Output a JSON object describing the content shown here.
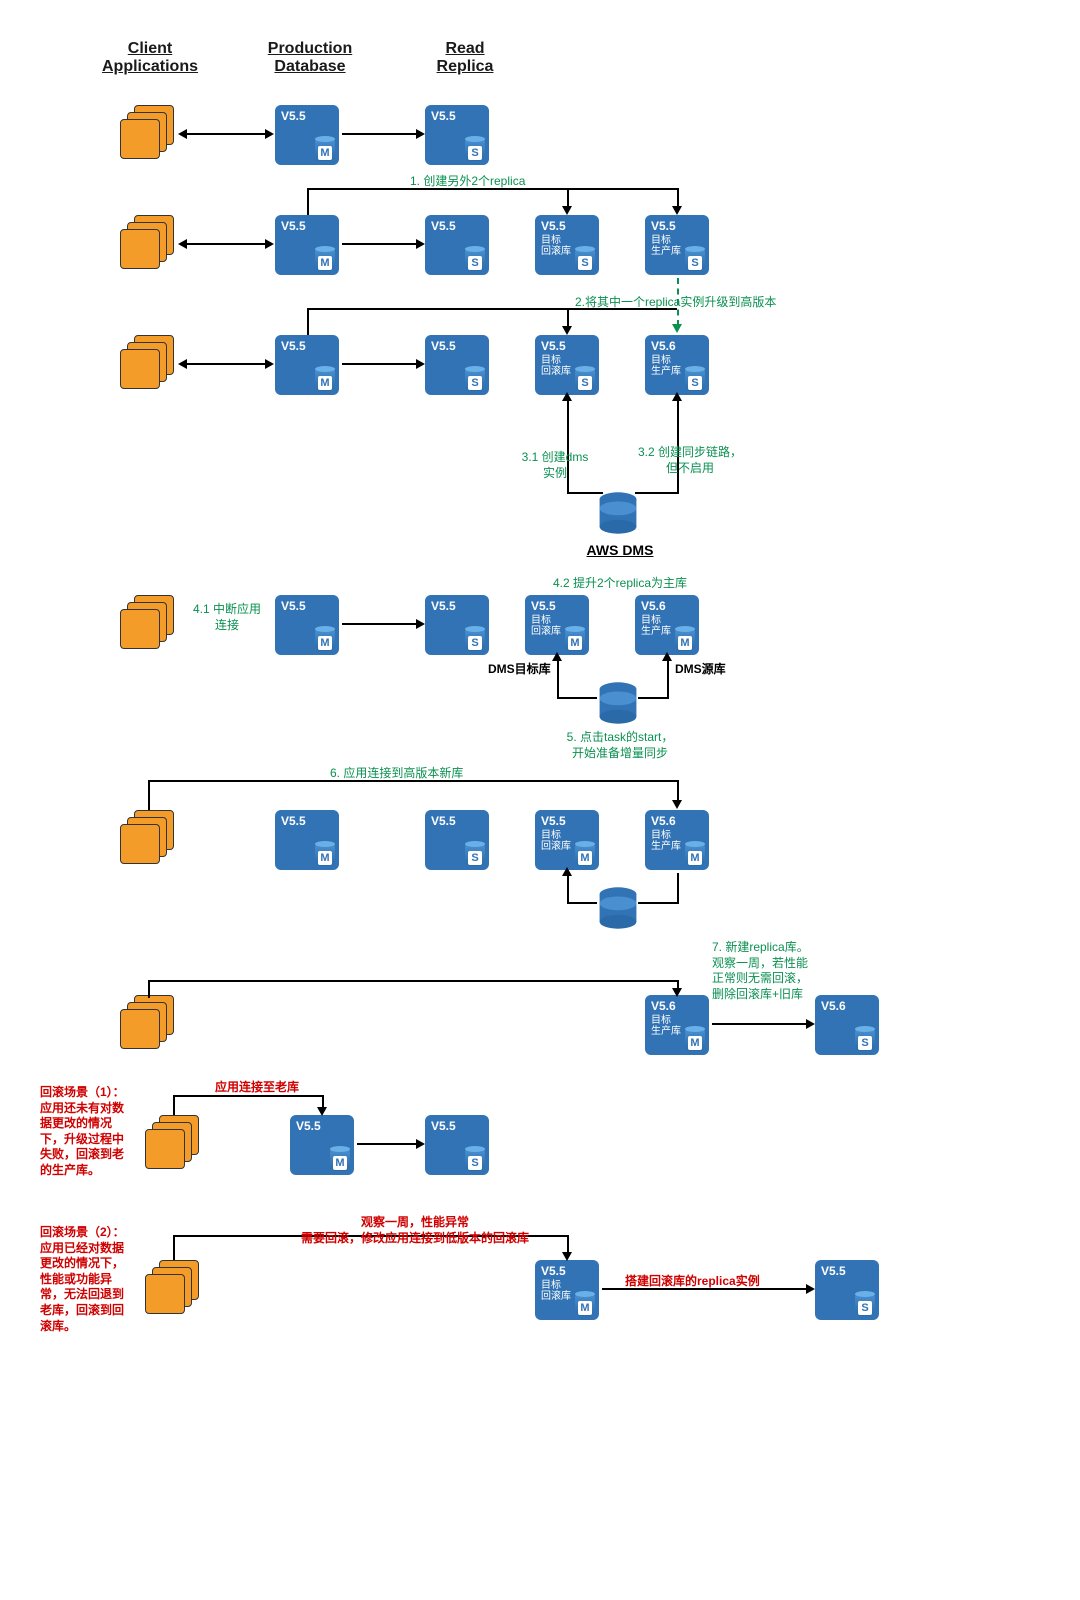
{
  "headers": {
    "client": "Client\nApplications",
    "prod": "Production\nDatabase",
    "replica": "Read\nReplica"
  },
  "version": {
    "v55": "V5.5",
    "v56": "V5.6"
  },
  "sublabel": {
    "rollback": "目标\n回滚库",
    "prod": "目标\n生产库"
  },
  "role": {
    "m": "M",
    "s": "S"
  },
  "steps": {
    "s1": "1. 创建另外2个replica",
    "s2": "2.将其中一个replica实例升级到高版本",
    "s31": "3.1 创建dms\n实例",
    "s32": "3.2 创建同步链路，\n但不启用",
    "s41": "4.1 中断应用\n连接",
    "s42": "4.2 提升2个replica为主库",
    "s5": "5. 点击task的start，\n开始准备增量同步",
    "s6": "6. 应用连接到高版本新库",
    "s7": "7. 新建replica库。\n观察一周，若性能\n正常则无需回滚，\n删除回滚库+旧库"
  },
  "dms_label": "AWS DMS",
  "dms_conn": {
    "target": "DMS目标库",
    "source": "DMS源库"
  },
  "rollback1": {
    "title": "回滚场景（1）：\n应用还未有对数\n据更改的情况\n下，升级过程中\n失败，回滚到老\n的生产库。",
    "arrow": "应用连接至老库"
  },
  "rollback2": {
    "title": "回滚场景（2）：\n应用已经对数据\n更改的情况下，\n性能或功能异\n常，无法回退到\n老库，回滚到回\n滚库。",
    "arrow": "观察一周，性能异常\n需要回滚，修改应用连接到低版本的回滚库",
    "replica_arrow": "搭建回滚库的replica实例"
  }
}
